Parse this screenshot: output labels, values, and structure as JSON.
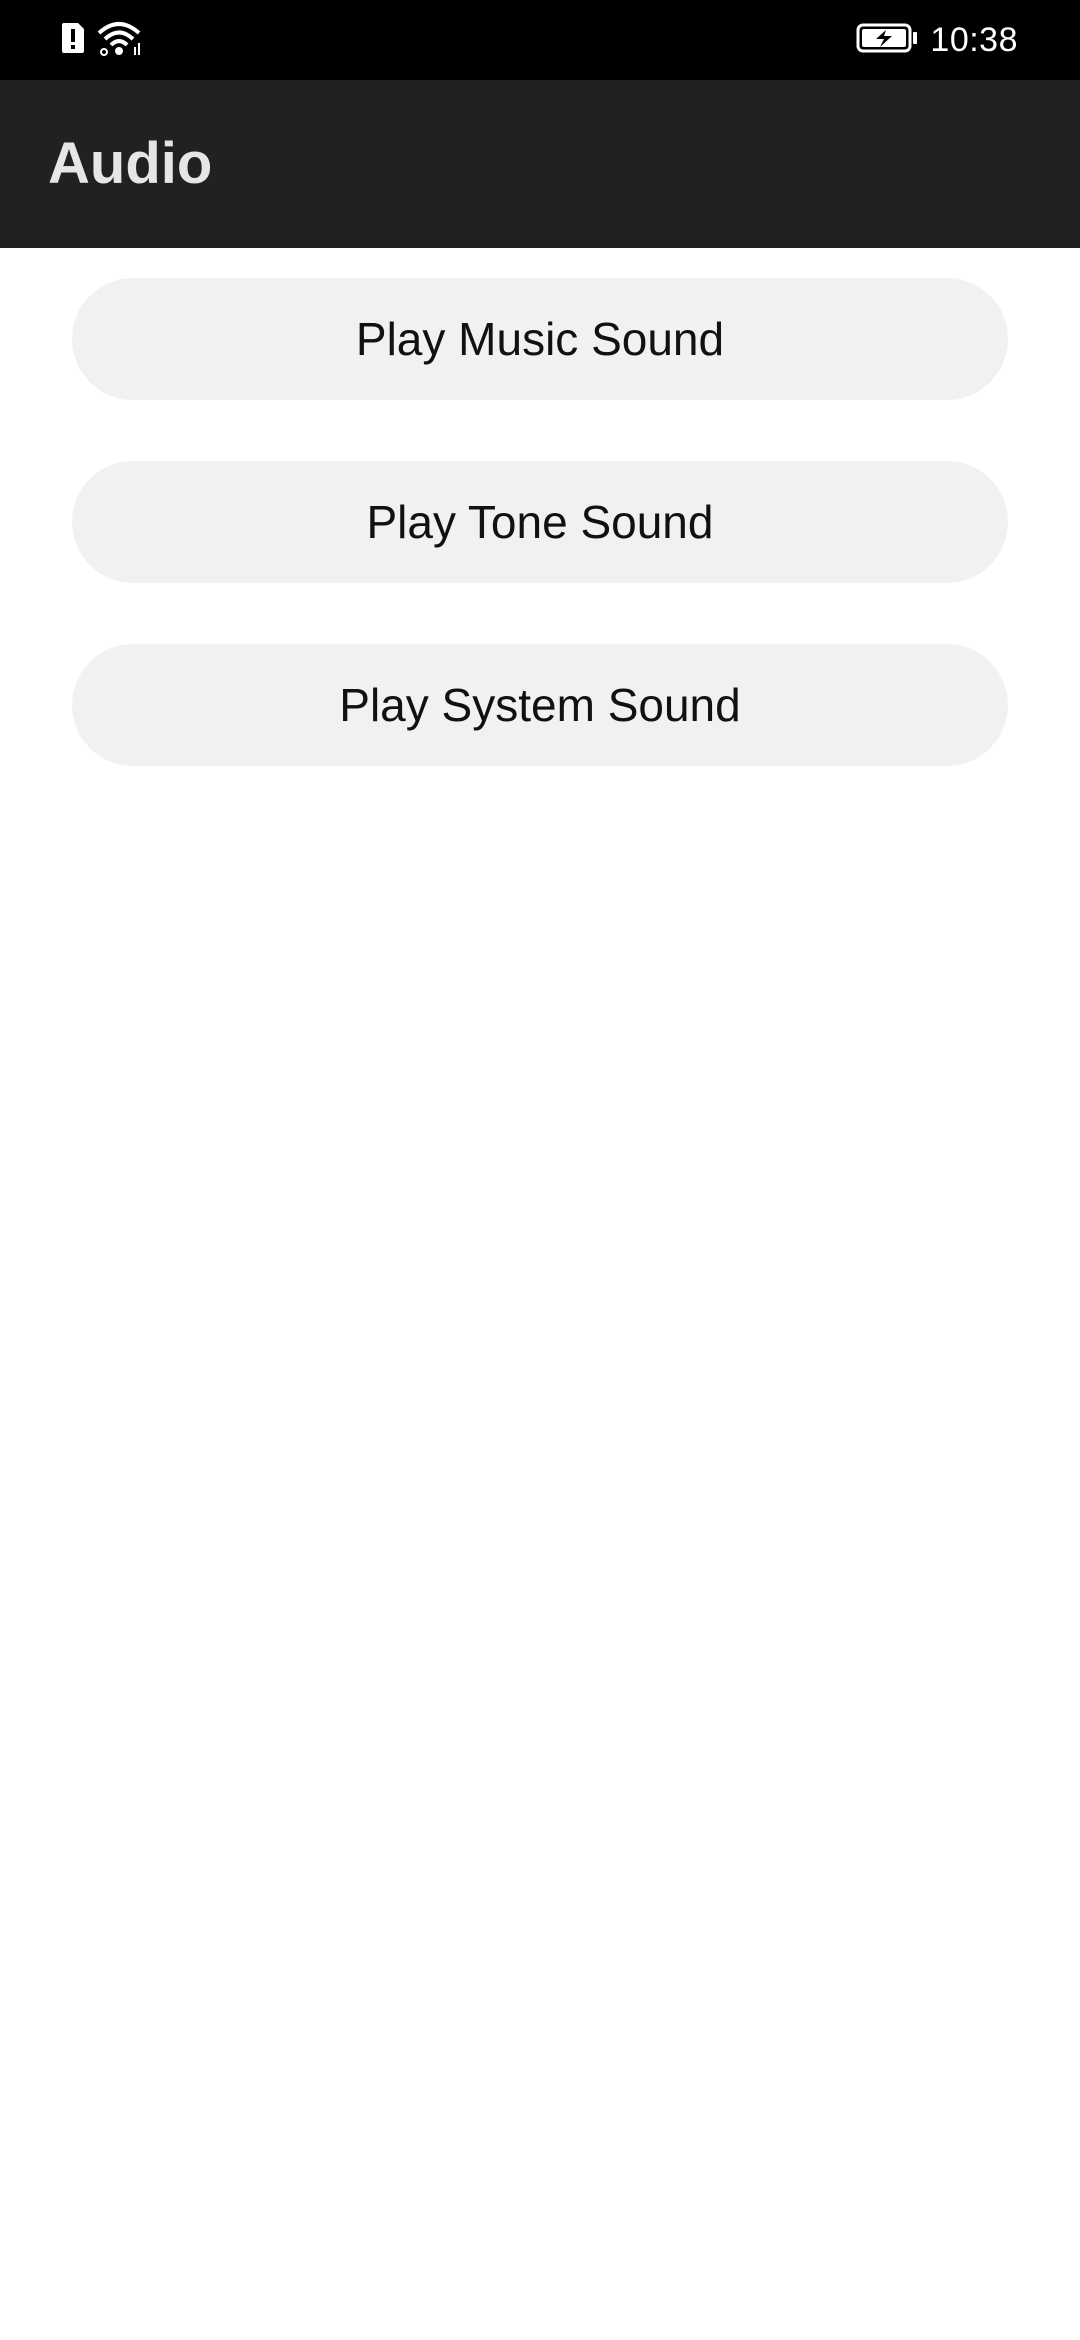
{
  "status_bar": {
    "time": "10:38",
    "icons": [
      "alert-icon",
      "wifi-icon",
      "battery-charging-icon"
    ]
  },
  "app_bar": {
    "title": "Audio"
  },
  "buttons": {
    "music": "Play Music Sound",
    "tone": "Play Tone Sound",
    "system": "Play System Sound"
  },
  "colors": {
    "status_bar_bg": "#000000",
    "app_bar_bg": "#212121",
    "button_bg": "#f1f1f1",
    "title_text": "#e6e6e6"
  }
}
